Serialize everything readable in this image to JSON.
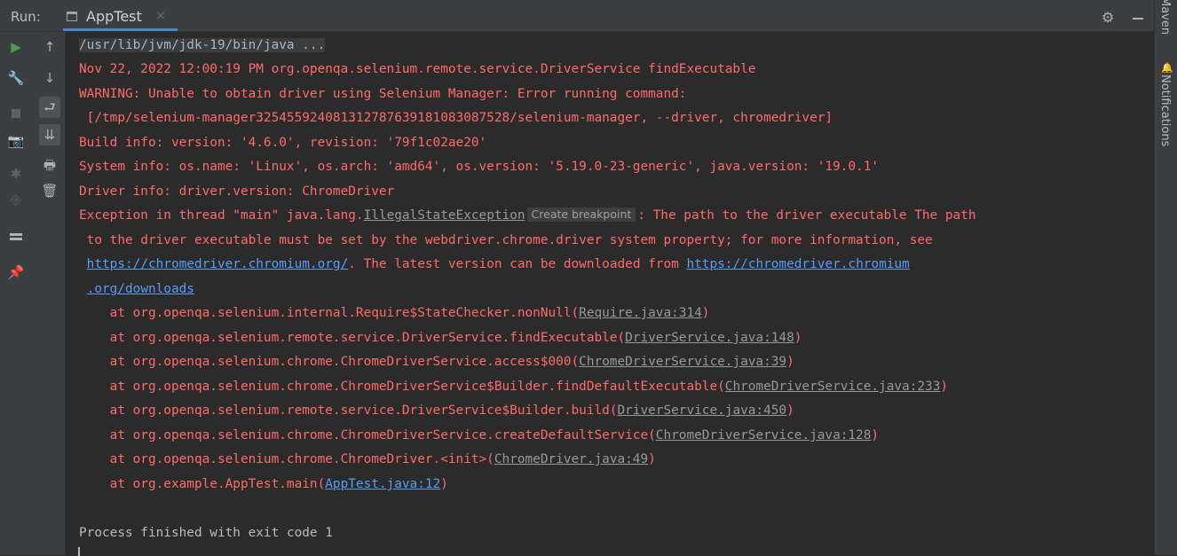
{
  "header": {
    "run_label": "Run:",
    "tab_title": "AppTest",
    "tab_close": "×",
    "gear_glyph": "⚙"
  },
  "right_strip": {
    "maven_label": "Maven",
    "notifications_label": "Notifications",
    "bell_glyph": "🔔"
  },
  "toolbar": {
    "run_glyph": "▶",
    "up_glyph": "↑",
    "down_glyph": "↓",
    "wrench_glyph": "🔧",
    "soft_wrap_glyph": "⮐",
    "camera_glyph": "📷",
    "scroll_end_glyph": "⇊",
    "debug_glyph": "✱",
    "print_glyph": "🖶",
    "exit_glyph": "⎆",
    "trash_glyph": "🗑",
    "pin_glyph": "📌"
  },
  "console": {
    "command": "/usr/lib/jvm/jdk-19/bin/java ...",
    "line_date": "Nov 22, 2022 12:00:19 PM org.openqa.selenium.remote.service.DriverService findExecutable",
    "line_warning": "WARNING: Unable to obtain driver using Selenium Manager: Error running command:",
    "line_warning_cont": " [/tmp/selenium-manager325455924081312787639181083087528/selenium-manager, --driver, chromedriver]",
    "line_build": "Build info: version: '4.6.0', revision: '79f1c02ae20'",
    "line_system": "System info: os.name: 'Linux', os.arch: 'amd64', os.version: '5.19.0-23-generic', java.version: '19.0.1'",
    "line_driver": "Driver info: driver.version: ChromeDriver",
    "exception": {
      "prefix": "Exception in thread \"main\" java.lang.",
      "name": "IllegalStateException",
      "breakpoint_label": "Create breakpoint",
      "message": ": The path to the driver executable The path",
      "message_cont": " to the driver executable must be set by the webdriver.chrome.driver system property; for more information, see",
      "link1": "https://chromedriver.chromium.org/",
      "mid_text": ". The latest version can be downloaded from ",
      "link2_part1": "https://chromedriver.chromium",
      "link2_part2": ".org/downloads"
    },
    "stack": [
      {
        "method": "    at org.openqa.selenium.internal.Require$StateChecker.nonNull(",
        "file": "Require.java:314",
        "close": ")"
      },
      {
        "method": "    at org.openqa.selenium.remote.service.DriverService.findExecutable(",
        "file": "DriverService.java:148",
        "close": ")"
      },
      {
        "method": "    at org.openqa.selenium.chrome.ChromeDriverService.access$000(",
        "file": "ChromeDriverService.java:39",
        "close": ")"
      },
      {
        "method": "    at org.openqa.selenium.chrome.ChromeDriverService$Builder.findDefaultExecutable(",
        "file": "ChromeDriverService.java:233",
        "close": ")"
      },
      {
        "method": "    at org.openqa.selenium.remote.service.DriverService$Builder.build(",
        "file": "DriverService.java:450",
        "close": ")"
      },
      {
        "method": "    at org.openqa.selenium.chrome.ChromeDriverService.createDefaultService(",
        "file": "ChromeDriverService.java:128",
        "close": ")"
      },
      {
        "method": "    at org.openqa.selenium.chrome.ChromeDriver.<init>(",
        "file": "ChromeDriver.java:49",
        "close": ")"
      },
      {
        "method": "    at org.example.AppTest.main(",
        "file": "AppTest.java:12",
        "close": ")"
      }
    ],
    "process_finished": "Process finished with exit code 1"
  },
  "colors": {
    "error_text": "#ff6b68",
    "link_blue": "#589df6",
    "link_gray": "#999999",
    "background": "#2b2b2b",
    "toolbar_bg": "#3c3f41",
    "tab_underline": "#4a88c7"
  }
}
